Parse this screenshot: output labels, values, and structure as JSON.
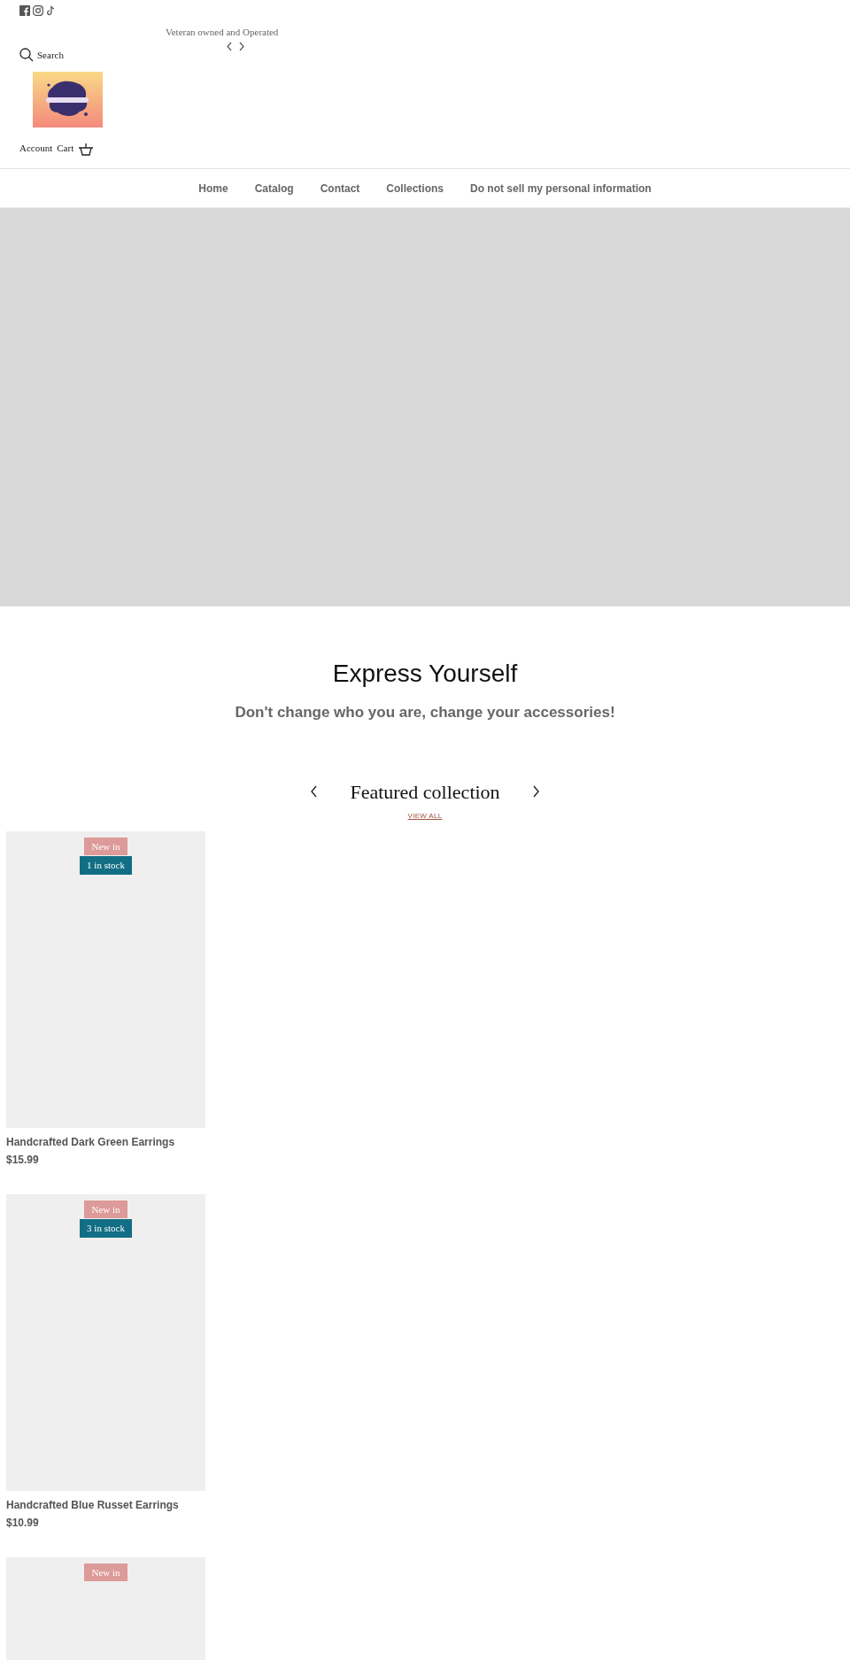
{
  "announcement": {
    "text": "Veteran owned and Operated"
  },
  "header": {
    "search_label": "Search",
    "account_label": "Account",
    "cart_label": "Cart"
  },
  "nav": {
    "items": [
      {
        "label": "Home"
      },
      {
        "label": "Catalog"
      },
      {
        "label": "Contact"
      },
      {
        "label": "Collections"
      },
      {
        "label": "Do not sell my personal information"
      }
    ]
  },
  "intro": {
    "title": "Express Yourself",
    "subtitle": "Don't change who you are, change your accessories!"
  },
  "featured": {
    "title": "Featured collection",
    "view_all": "VIEW ALL",
    "products": [
      {
        "badges": [
          {
            "text": "New in",
            "kind": "new"
          },
          {
            "text": "1 in stock",
            "kind": "stock"
          }
        ],
        "title": "Handcrafted Dark Green Earrings",
        "price": "$15.99"
      },
      {
        "badges": [
          {
            "text": "New in",
            "kind": "new"
          },
          {
            "text": "3 in stock",
            "kind": "stock"
          }
        ],
        "title": "Handcrafted Blue Russet Earrings",
        "price": "$10.99"
      },
      {
        "badges": [
          {
            "text": "New in",
            "kind": "new"
          }
        ]
      }
    ]
  }
}
